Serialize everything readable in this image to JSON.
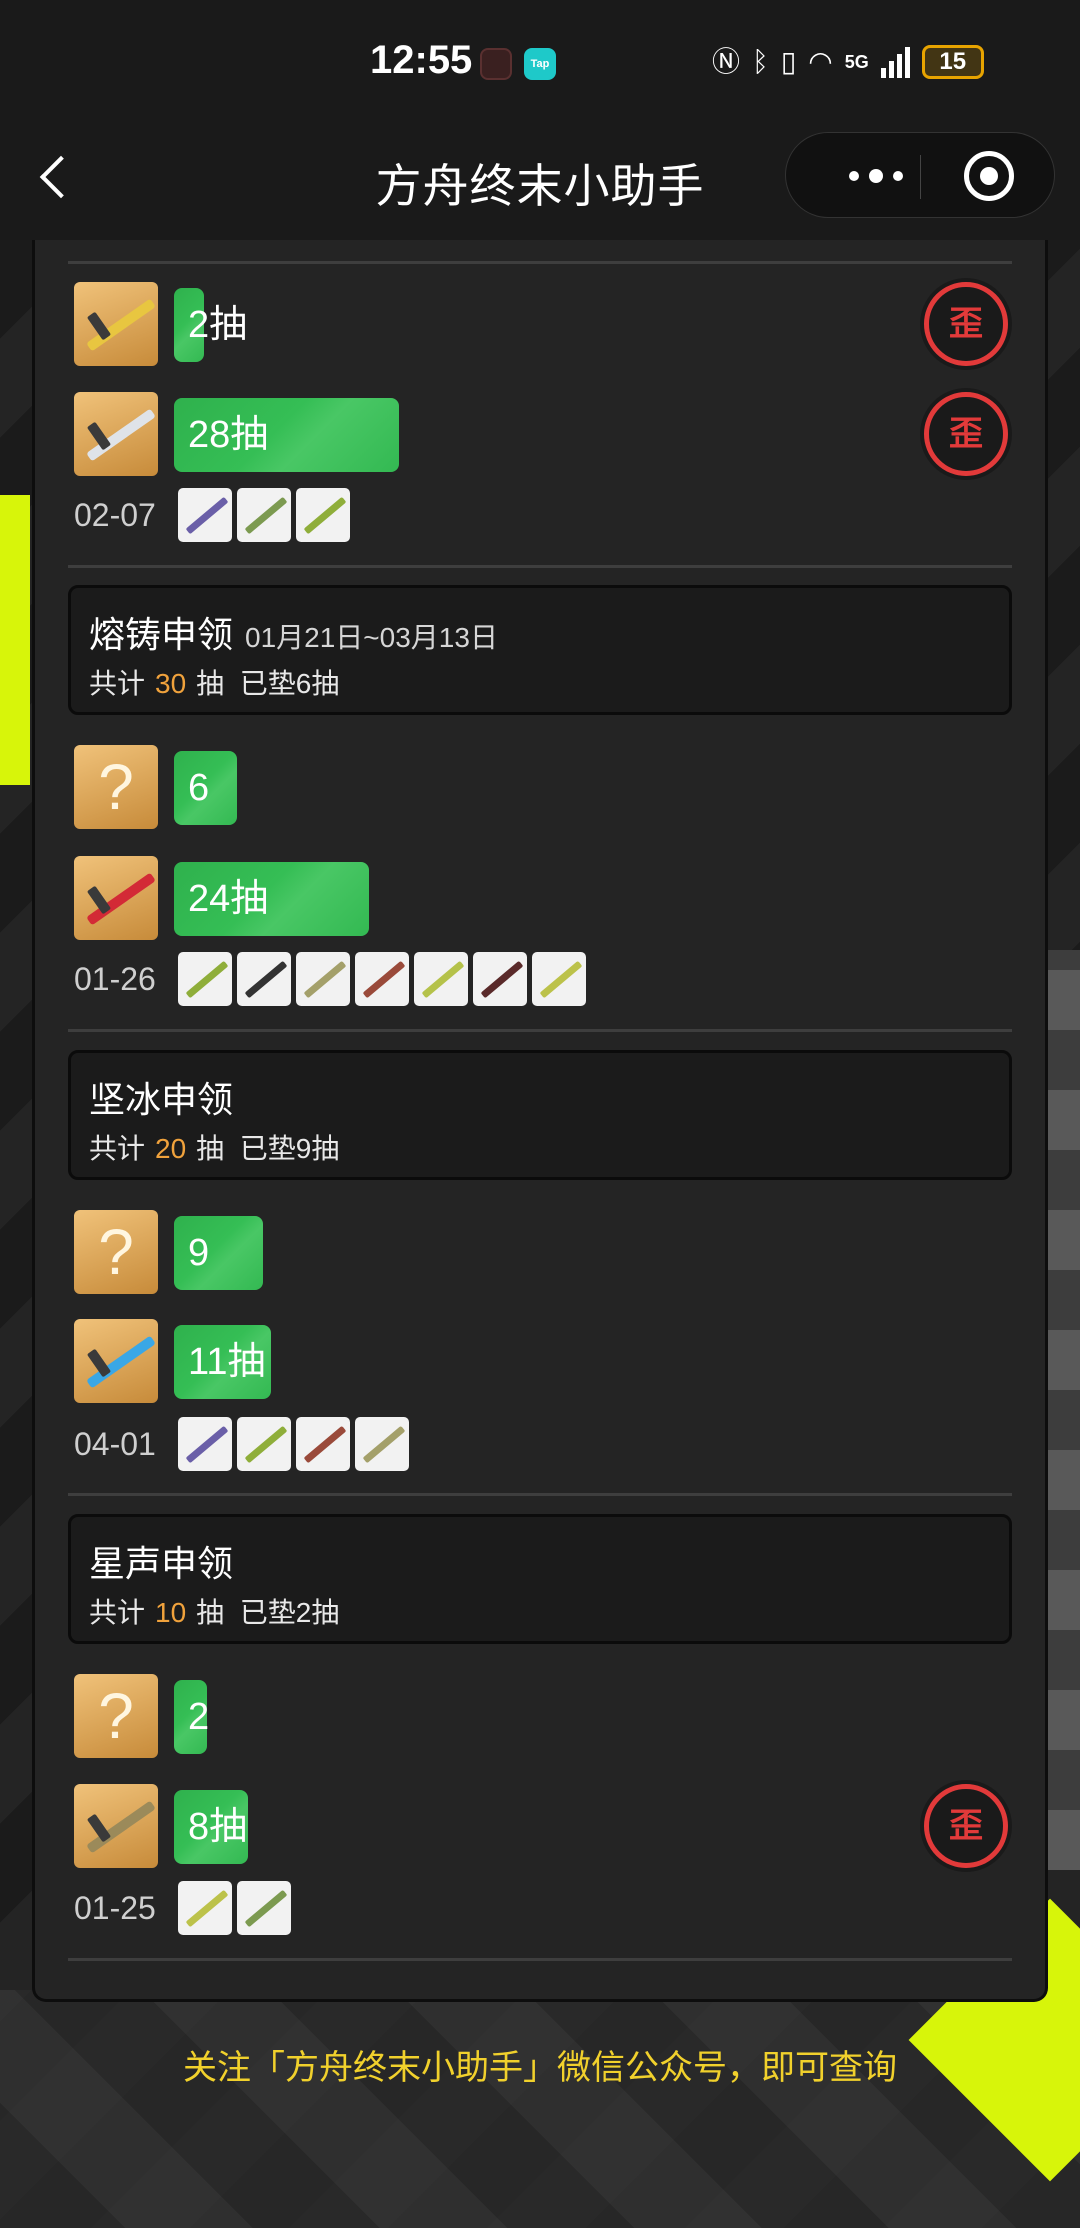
{
  "status_bar": {
    "time": "12:55",
    "tap_label": "Tap",
    "battery": "15",
    "net": "5G"
  },
  "nav": {
    "title": "方舟终末小助手"
  },
  "wai_label": "歪",
  "unknown_label": "?",
  "groups": [
    {
      "rows": [
        {
          "count": "2抽",
          "icon": "golden-sword",
          "wai": true
        },
        {
          "count": "28抽",
          "icon": "silver-sword",
          "wai": true
        }
      ],
      "date": "02-07",
      "thumbs": [
        "purple-gun",
        "green-sword",
        "green-rifle"
      ]
    },
    {
      "banner": {
        "name": "熔铸申领",
        "dates": "01月21日~03月13日",
        "total_prefix": "共计",
        "total": "30",
        "total_suffix": "抽",
        "pity": "已垫6抽"
      },
      "rows": [
        {
          "count": "6",
          "icon": "unknown",
          "wai": false
        },
        {
          "count": "24抽",
          "icon": "red-sword",
          "wai": false
        }
      ],
      "date": "01-26",
      "thumbs": [
        "green-rifle",
        "black-blade",
        "armor-unit",
        "red-spear",
        "green-rifle",
        "dark-gear",
        "yellow-gun"
      ]
    },
    {
      "banner": {
        "name": "坚冰申领",
        "dates": "",
        "total_prefix": "共计",
        "total": "20",
        "total_suffix": "抽",
        "pity": "已垫9抽"
      },
      "rows": [
        {
          "count": "9",
          "icon": "unknown",
          "wai": false
        },
        {
          "count": "11抽",
          "icon": "blue-sword",
          "wai": false
        }
      ],
      "date": "04-01",
      "thumbs": [
        "purple-gun",
        "green-rifle",
        "red-spear",
        "armor-unit"
      ]
    },
    {
      "banner": {
        "name": "星声申领",
        "dates": "",
        "total_prefix": "共计",
        "total": "10",
        "total_suffix": "抽",
        "pity": "已垫2抽"
      },
      "rows": [
        {
          "count": "2",
          "icon": "unknown",
          "wai": false
        },
        {
          "count": "8抽",
          "icon": "bronze-polearm",
          "wai": true
        }
      ],
      "date": "01-25",
      "thumbs": [
        "yellow-gun",
        "green-sword"
      ]
    }
  ],
  "footer": {
    "text": "关注「方舟终末小助手」微信公众号，即可查询"
  },
  "colors": {
    "pull_bar": "#35be55",
    "wai_red": "#e23a3a",
    "stat_orange": "#f0a23c",
    "footer_yellow": "#f1d12c",
    "bg_yellow": "#d7f50a"
  }
}
